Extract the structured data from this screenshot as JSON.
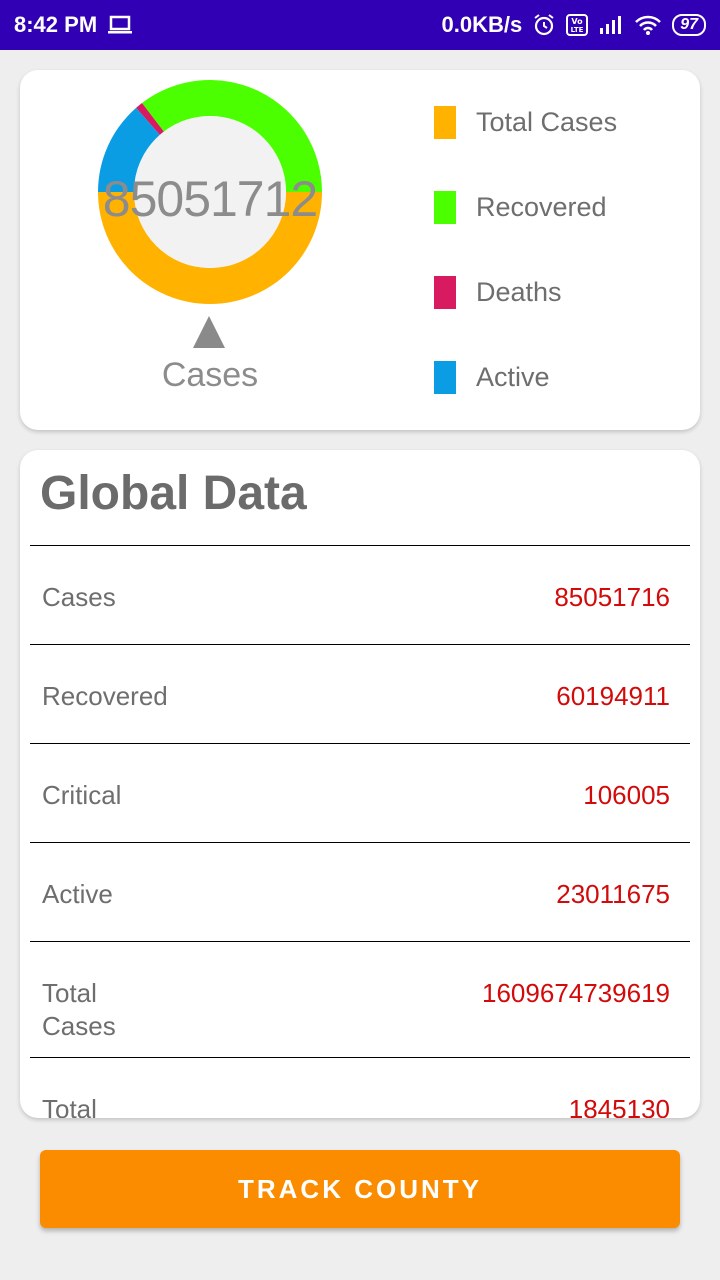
{
  "status_bar": {
    "time": "8:42 PM",
    "net_speed": "0.0KB/s",
    "volte": "Vo LTE",
    "battery": "97"
  },
  "chart_card": {
    "center_value": "85051712",
    "center_label": "Cases",
    "legend": [
      {
        "label": "Total Cases",
        "color": "#ffb300"
      },
      {
        "label": "Recovered",
        "color": "#4cff00"
      },
      {
        "label": "Deaths",
        "color": "#d81b60"
      },
      {
        "label": "Active",
        "color": "#0a9de4"
      }
    ]
  },
  "chart_data": {
    "type": "pie",
    "slices": [
      {
        "value": 85051716,
        "color": "#ffb300"
      },
      {
        "value": 60194911,
        "color": "#4cff00"
      },
      {
        "value": 1845130,
        "color": "#d81b60"
      },
      {
        "value": 23011675,
        "color": "#0a9de4"
      }
    ]
  },
  "global_data": {
    "title": "Global Data",
    "rows": [
      {
        "label": "Cases",
        "value": "85051716"
      },
      {
        "label": "Recovered",
        "value": "60194911"
      },
      {
        "label": "Critical",
        "value": "106005"
      },
      {
        "label": "Active",
        "value": "23011675"
      },
      {
        "label": "Total Cases",
        "value": "1609674739619"
      },
      {
        "label": "Total",
        "value": "1845130"
      }
    ]
  },
  "button": {
    "label": "TRACK COUNTY",
    "color": "#fb8c00"
  }
}
